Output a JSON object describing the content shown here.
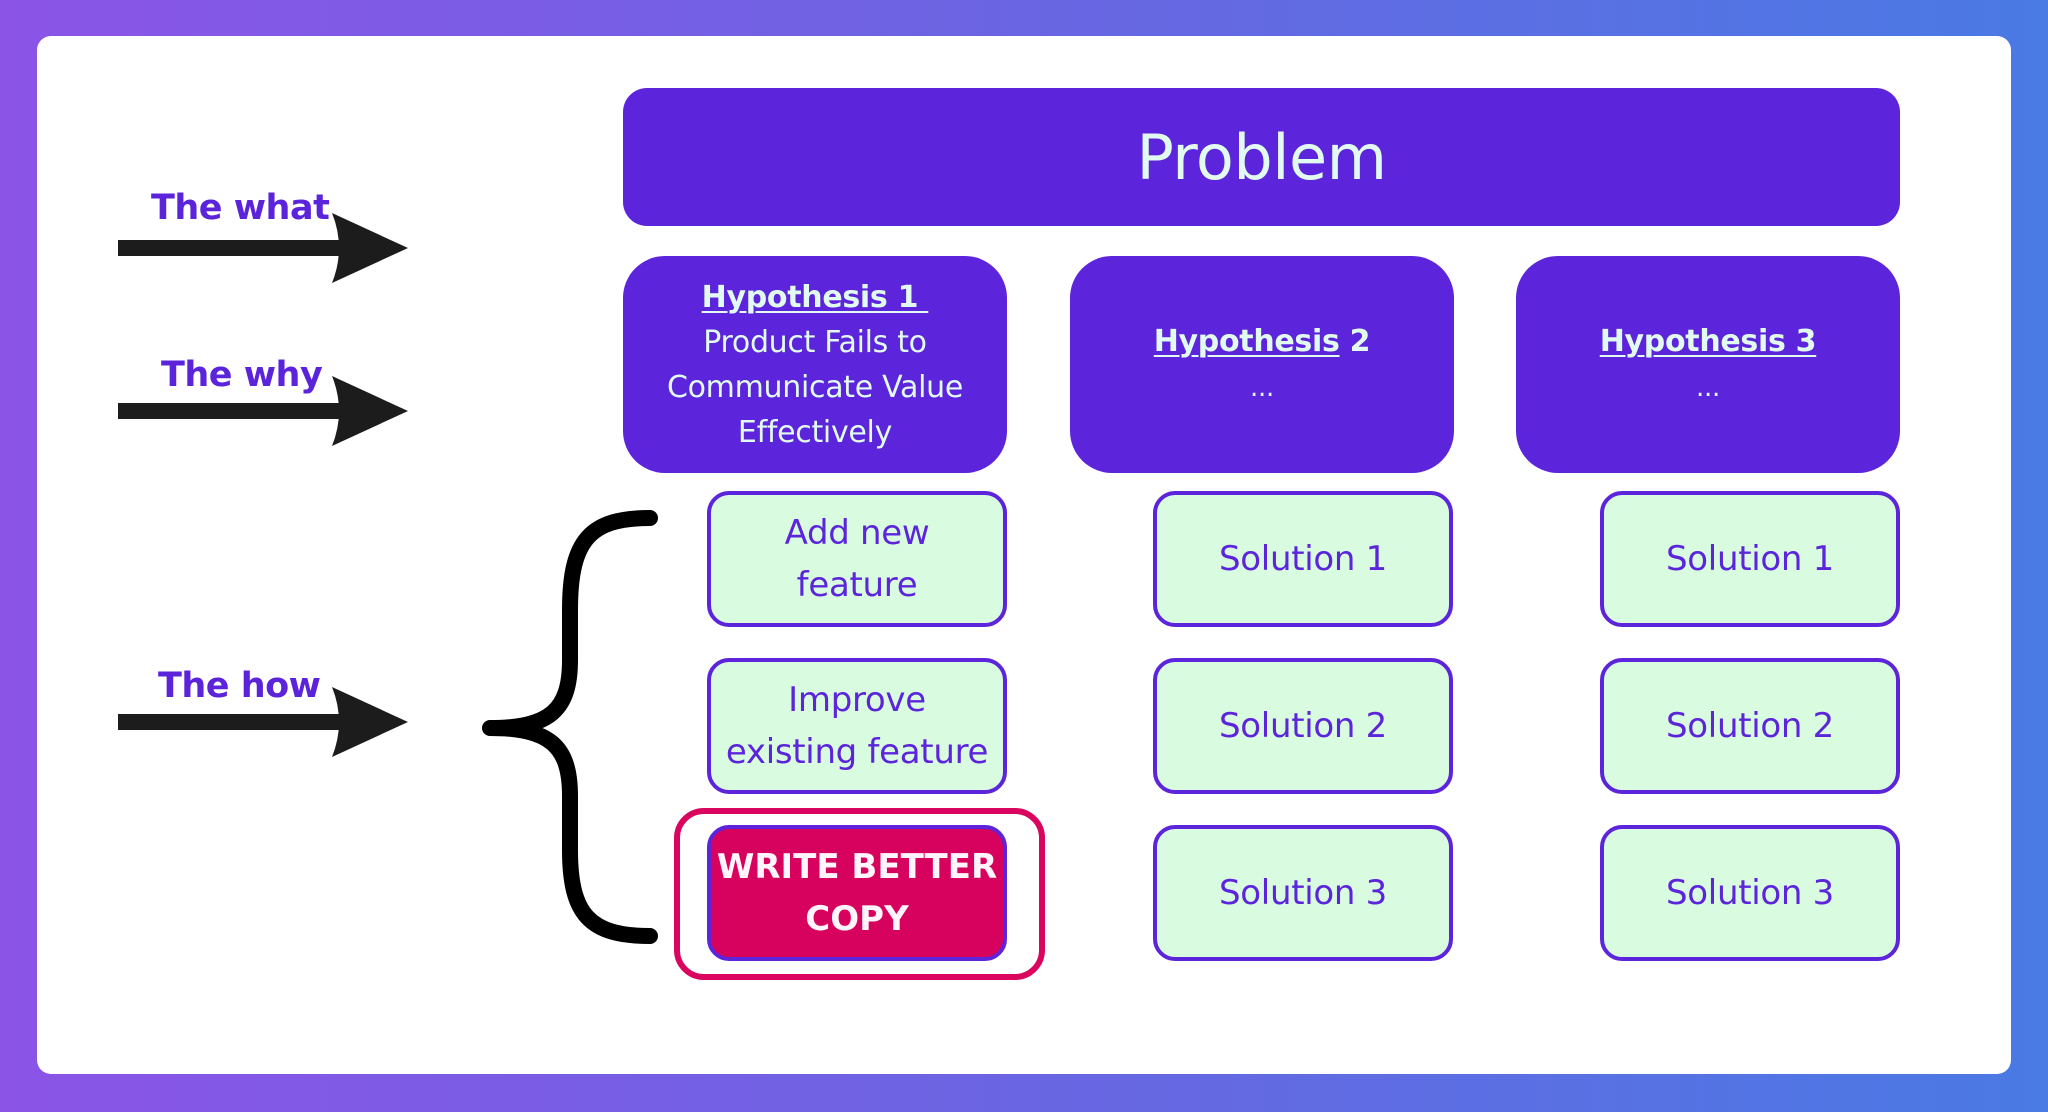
{
  "labels": {
    "what": "The what",
    "why": "The why",
    "how": "The how"
  },
  "problem": {
    "title": "Problem"
  },
  "hypotheses": [
    {
      "title_underlined": "Hypothesis 1 ",
      "title_rest": "",
      "lines": [
        "Product Fails to",
        "Communicate Value",
        "Effectively"
      ]
    },
    {
      "title_underlined": "Hypothesis",
      "title_rest": " 2",
      "detail": "..."
    },
    {
      "title_underlined": "Hypothesis 3",
      "title_rest": "",
      "detail": "..."
    }
  ],
  "solutions": {
    "column1": [
      {
        "lines": [
          "Add new",
          "feature"
        ]
      },
      {
        "lines": [
          "Improve",
          "existing feature"
        ]
      },
      {
        "lines": [
          "WRITE BETTER",
          "COPY"
        ],
        "highlighted": true
      }
    ],
    "column2": [
      "Solution 1",
      "Solution 2",
      "Solution 3"
    ],
    "column3": [
      "Solution 1",
      "Solution 2",
      "Solution 3"
    ]
  },
  "colors": {
    "primary_purple": "#5c24db",
    "solution_fill": "#d9fce1",
    "highlight_red": "#d6025d",
    "light_text": "#e2fbf0",
    "arrow_black": "#1c1c1c",
    "background_left": "#8b54e7",
    "background_right": "#4a7ae4"
  }
}
